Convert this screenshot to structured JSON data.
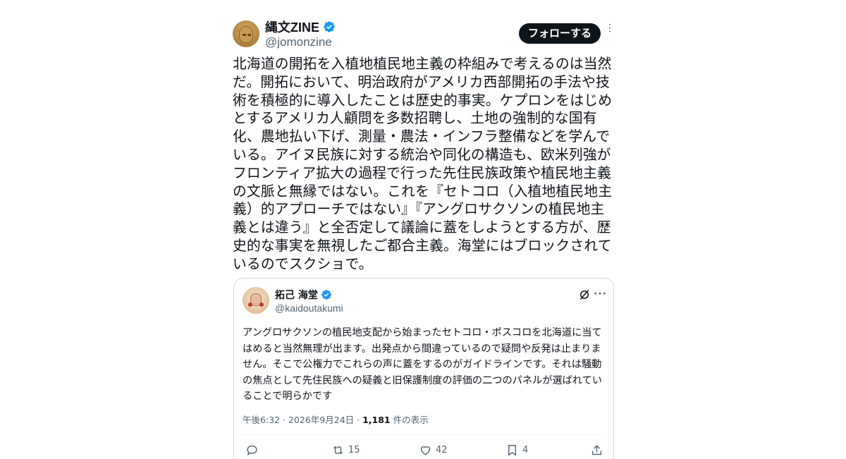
{
  "post": {
    "author_name": "縄文ZINE",
    "author_handle": "@jomonzine",
    "follow_label": "フォローする",
    "more_glyph": "⋮",
    "body_lines": [
      "北海道の開拓を入植地植民地主義の枠組みで考えるのは当然",
      "だ。開拓において、明治政府がアメリカ西部開拓の手法や技",
      "術を積極的に導入したことは歴史的事実。ケプロンをはじめ",
      "とするアメリカ人顧問を多数招聘し、土地の強制的な国有",
      "化、農地払い下げ、測量・農法・インフラ整備などを学んで",
      "いる。アイヌ民族に対する統治や同化の構造も、欧米列強が",
      "フロンティア拡大の過程で行った先住民族政策や植民地主義",
      "の文脈と無縁ではない。これを『セトコロ（入植地植民地主",
      "義）的アプローチではない』『アングロサクソンの植民地主",
      "義とは違う』と全否定して議論に蓋をしようとする方が、歴",
      "史的な事実を無視したご都合主義。海堂にはブロックされて",
      "いるのでスクショで。"
    ]
  },
  "quote": {
    "author_name": "拓己 海堂",
    "author_handle": "@kaidoutakumi",
    "more_glyph": "···",
    "text_lines": [
      "アングロサクソンの植民地支配から始まったセトコロ・ポスコロを北海道に当て",
      "はめると当然無理が出ます。出発点から間違っているので疑問や反発は止まりま",
      "せん。そこで公権力でこれらの声に蓋をするのがガイドラインです。それは騒動",
      "の焦点として先住民族への疑義と旧保護制度の評価の二つのパネルが選ばれてい",
      "ることで明らかです"
    ],
    "timestamp": "午後6:32 · 2026年9月24日 · ",
    "views_count": "1,181",
    "views_label": " 件の表示",
    "actions": {
      "reply_count": "",
      "retweet_count": "15",
      "like_count": "42",
      "bookmark_count": "4"
    }
  },
  "colors": {
    "verified_blue": "#1d9bf0",
    "text_primary": "#0f1419",
    "text_secondary": "#536471",
    "border": "#cfd9de"
  },
  "icons": [
    "verified-badge-icon",
    "grok-icon",
    "reply-icon",
    "retweet-icon",
    "like-icon",
    "bookmark-icon",
    "share-icon"
  ]
}
